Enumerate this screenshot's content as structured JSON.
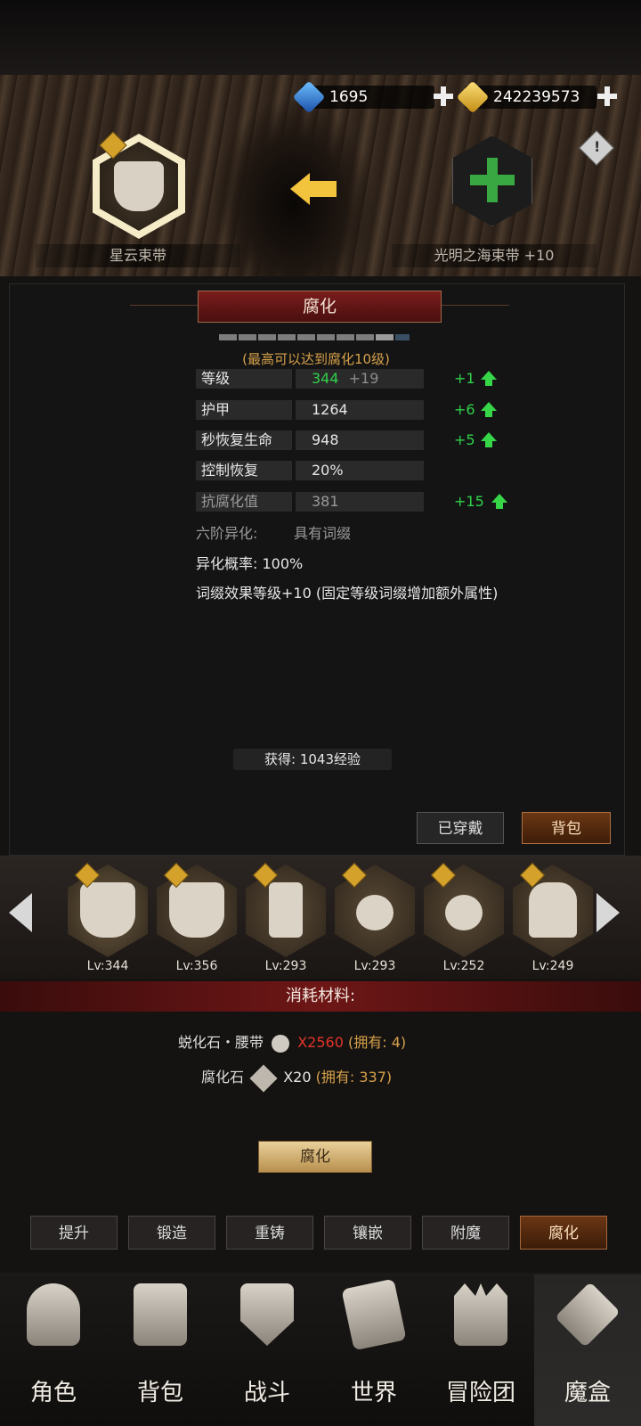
{
  "currency": {
    "gems": "1695",
    "gold": "242239573"
  },
  "compare": {
    "left_name": "星云束带",
    "right_name": "光明之海束带 +10"
  },
  "panel": {
    "title": "腐化",
    "max_note": "(最高可以达到腐化10级)",
    "stats": [
      {
        "label": "等级",
        "value": "344",
        "extra": "+19",
        "inc": "+1"
      },
      {
        "label": "护甲",
        "value": "1264",
        "extra": "",
        "inc": "+6"
      },
      {
        "label": "秒恢复生命",
        "value": "948",
        "extra": "",
        "inc": "+5"
      },
      {
        "label": "控制恢复",
        "value": "20%",
        "extra": "",
        "inc": ""
      },
      {
        "label": "抗腐化值",
        "value": "381",
        "extra": "",
        "inc": "+15"
      }
    ],
    "mutation_label": "六阶异化:",
    "mutation_value": "具有词缀",
    "mutation_rate": "异化概率: 100%",
    "affix_note": "词缀效果等级+10 (固定等级词缀增加额外属性)",
    "exp_gain": "获得: 1043经验",
    "btn_equipped": "已穿戴",
    "btn_bag": "背包"
  },
  "items": [
    {
      "level": "Lv:344",
      "icon": "belt-icon"
    },
    {
      "level": "Lv:356",
      "icon": "belt-icon"
    },
    {
      "level": "Lv:293",
      "icon": "boots-icon"
    },
    {
      "level": "Lv:293",
      "icon": "charm-icon"
    },
    {
      "level": "Lv:252",
      "icon": "charm-icon"
    },
    {
      "level": "Lv:249",
      "icon": "cloth-icon"
    }
  ],
  "materials": {
    "title": "消耗材料:",
    "rows": [
      {
        "name": "蜕化石・腰带",
        "qty": "X2560",
        "owned": "(拥有: 4)"
      },
      {
        "name": "腐化石",
        "qty": "X20",
        "owned": "(拥有: 337)"
      }
    ],
    "action": "腐化"
  },
  "tabs": [
    "提升",
    "锻造",
    "重铸",
    "镶嵌",
    "附魔",
    "腐化"
  ],
  "nav": [
    "角色",
    "背包",
    "战斗",
    "世界",
    "冒险团",
    "魔盒"
  ],
  "colors": {
    "accent_green": "#2fd14a",
    "qty_red": "#e0342a",
    "owned_gold": "#d6a04a"
  }
}
